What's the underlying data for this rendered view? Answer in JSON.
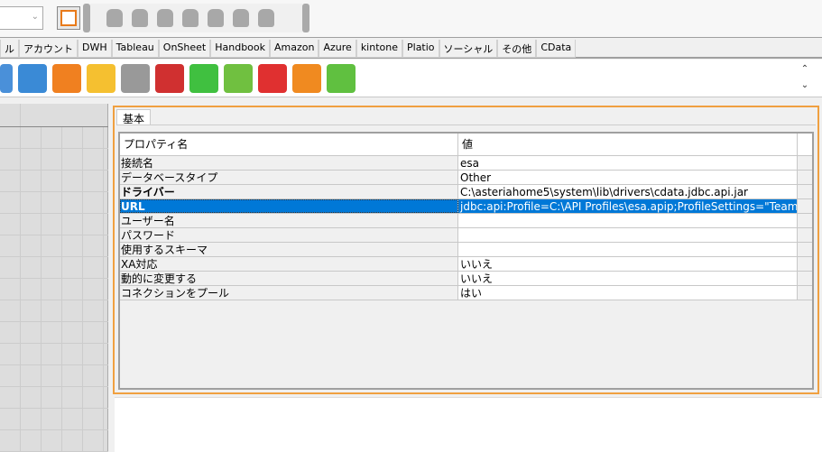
{
  "toolbar": {
    "combo_value": "",
    "fit_button": "fit-to-window"
  },
  "category_tabs": [
    "ル",
    "アカウント",
    "DWH",
    "Tableau",
    "OnSheet",
    "Handbook",
    "Amazon",
    "Azure",
    "kintone",
    "Platio",
    "ソーシャル",
    "その他",
    "CData"
  ],
  "component_icons": [
    {
      "name": "user-network-icon",
      "color": "#4a90d9"
    },
    {
      "name": "network-computers-icon",
      "color": "#3a8ad6"
    },
    {
      "name": "arrow-merge-icon",
      "color": "#f08020"
    },
    {
      "name": "sleep-moon-icon",
      "color": "#f5c030"
    },
    {
      "name": "plug-icon",
      "color": "#999999"
    },
    {
      "name": "joystick-drive-icon",
      "color": "#d03030"
    },
    {
      "name": "globe-icon",
      "color": "#40c040"
    },
    {
      "name": "flow-diagram-icon",
      "color": "#70c040"
    },
    {
      "name": "upload-red-icon",
      "color": "#e03030"
    },
    {
      "name": "refresh-orange-icon",
      "color": "#f08a20"
    },
    {
      "name": "upload-green-icon",
      "color": "#60c040"
    }
  ],
  "panel": {
    "tab": "基本",
    "header": {
      "name": "プロパティ名",
      "value": "値"
    },
    "rows": [
      {
        "name": "接続名",
        "value": "esa"
      },
      {
        "name": "データベースタイプ",
        "value": "Other"
      },
      {
        "name": "ドライバー",
        "value": "C:\\asteriahome5\\system\\lib\\drivers\\cdata.jdbc.api.jar"
      },
      {
        "name": "URL",
        "value": "jdbc:api:Profile=C:\\API Profiles\\esa.apip;ProfileSettings=\"TeamNa..."
      },
      {
        "name": "ユーザー名",
        "value": ""
      },
      {
        "name": "パスワード",
        "value": ""
      },
      {
        "name": "使用するスキーマ",
        "value": ""
      },
      {
        "name": "XA対応",
        "value": "いいえ"
      },
      {
        "name": "動的に変更する",
        "value": "いいえ"
      },
      {
        "name": "コネクションをプール",
        "value": "はい"
      }
    ]
  },
  "colors": {
    "accent": "#f0a040",
    "selection": "#0078d7"
  }
}
